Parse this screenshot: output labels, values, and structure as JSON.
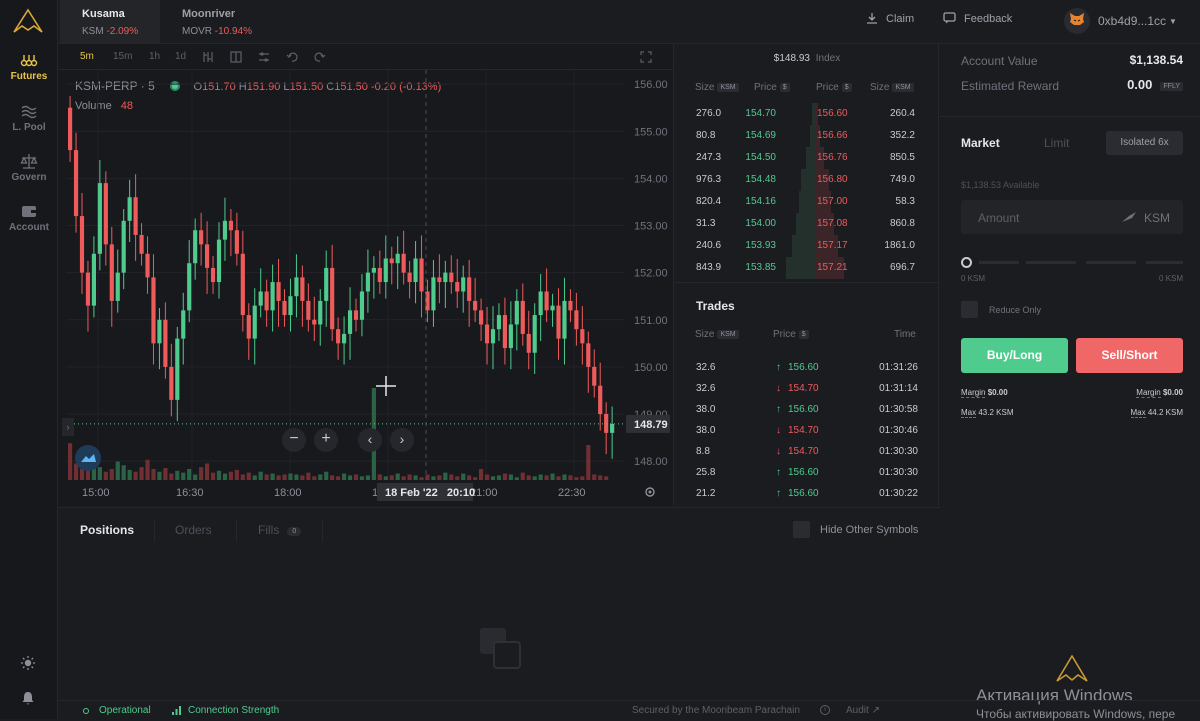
{
  "nav": {
    "items": [
      {
        "label": "Futures",
        "icon": "futures-icon"
      },
      {
        "label": "L. Pool",
        "icon": "pool-icon"
      },
      {
        "label": "Govern",
        "icon": "scale-icon"
      },
      {
        "label": "Account",
        "icon": "wallet-icon"
      }
    ]
  },
  "markets": [
    {
      "name": "Kusama",
      "symbol": "KSM",
      "change": "-2.09%"
    },
    {
      "name": "Moonriver",
      "symbol": "MOVR",
      "change": "-10.94%"
    }
  ],
  "topbar": {
    "claim": "Claim",
    "feedback": "Feedback",
    "wallet": "0xb4d9...1cc"
  },
  "chart_toolbar": {
    "timeframes": [
      "5m",
      "15m",
      "1h",
      "1d"
    ]
  },
  "chart_data": {
    "type": "candlestick",
    "symbol_label": "KSM-PERP · 5",
    "ohlc": {
      "o": "151.70",
      "h": "151.90",
      "l": "151.50",
      "c": "151.50",
      "change": "-0.20 (-0.13%)"
    },
    "volume_label": "Volume",
    "volume_value": "48",
    "y_ticks": [
      "156.00",
      "155.00",
      "154.00",
      "153.00",
      "152.00",
      "151.00",
      "150.00",
      "149.00",
      "148.00"
    ],
    "ylim": [
      147.6,
      156.3
    ],
    "x_ticks": [
      "15:00",
      "16:30",
      "18:00",
      "19:30",
      "21:00",
      "22:30"
    ],
    "last_price": "148.79",
    "crosshair_label": "18 Feb '22   20:10",
    "closes": [
      154.6,
      153.2,
      152.0,
      151.3,
      152.4,
      153.9,
      152.6,
      151.4,
      152.0,
      153.1,
      153.6,
      152.8,
      152.4,
      151.9,
      150.5,
      151.0,
      150.0,
      149.3,
      150.6,
      151.2,
      152.2,
      152.9,
      152.6,
      152.1,
      151.8,
      152.7,
      153.1,
      152.9,
      152.4,
      151.1,
      150.6,
      151.3,
      151.6,
      151.2,
      151.8,
      151.4,
      151.1,
      151.5,
      151.9,
      151.4,
      151.0,
      150.9,
      151.4,
      152.1,
      150.8,
      150.5,
      150.7,
      151.2,
      151.0,
      151.6,
      152.0,
      152.1,
      151.8,
      152.3,
      152.2,
      152.4,
      152.0,
      151.8,
      152.3,
      151.6,
      151.2,
      151.9,
      151.8,
      152.0,
      151.8,
      151.6,
      151.9,
      151.4,
      151.2,
      150.9,
      150.5,
      150.8,
      151.1,
      150.4,
      150.9,
      151.4,
      150.7,
      150.3,
      151.1,
      151.6,
      151.2,
      151.3,
      150.6,
      151.4,
      151.2,
      150.8,
      150.5,
      150.0,
      149.6,
      149.0,
      148.6,
      148.79
    ],
    "volumes": [
      40,
      18,
      12,
      22,
      30,
      14,
      9,
      12,
      20,
      16,
      11,
      9,
      14,
      22,
      12,
      9,
      13,
      7,
      10,
      8,
      12,
      6,
      14,
      18,
      8,
      10,
      7,
      9,
      11,
      6,
      8,
      5,
      9,
      6,
      7,
      5,
      6,
      7,
      6,
      5,
      8,
      4,
      6,
      9,
      5,
      4,
      7,
      5,
      6,
      4,
      5,
      100,
      6,
      4,
      5,
      7,
      4,
      6,
      5,
      3,
      6,
      4,
      5,
      8,
      6,
      4,
      7,
      5,
      3,
      12,
      6,
      4,
      5,
      7,
      6,
      3,
      8,
      5,
      4,
      6,
      5,
      7,
      4,
      6,
      5,
      3,
      4,
      38,
      6,
      5,
      4
    ]
  },
  "orderbook": {
    "index_price": "$148.93",
    "index_label": "Index",
    "headers": {
      "size": "Size",
      "price": "Price",
      "unit_ksm": "KSM",
      "unit_usd": "$"
    },
    "rows": [
      {
        "bid_size": "276.0",
        "bid": "154.70",
        "ask": "156.60",
        "ask_size": "260.4",
        "depth": 0.1
      },
      {
        "bid_size": "80.8",
        "bid": "154.69",
        "ask": "156.66",
        "ask_size": "352.2",
        "depth": 0.18
      },
      {
        "bid_size": "247.3",
        "bid": "154.50",
        "ask": "156.76",
        "ask_size": "850.5",
        "depth": 0.3
      },
      {
        "bid_size": "976.3",
        "bid": "154.48",
        "ask": "156.80",
        "ask_size": "749.0",
        "depth": 0.45
      },
      {
        "bid_size": "820.4",
        "bid": "154.16",
        "ask": "157.00",
        "ask_size": "58.3",
        "depth": 0.52
      },
      {
        "bid_size": "31.3",
        "bid": "154.00",
        "ask": "157.08",
        "ask_size": "860.8",
        "depth": 0.62
      },
      {
        "bid_size": "240.6",
        "bid": "153.93",
        "ask": "157.17",
        "ask_size": "1861.0",
        "depth": 0.78
      },
      {
        "bid_size": "843.9",
        "bid": "153.85",
        "ask": "157.21",
        "ask_size": "696.7",
        "depth": 0.95
      }
    ]
  },
  "trades": {
    "title": "Trades",
    "headers": {
      "size": "Size",
      "price": "Price",
      "time": "Time"
    },
    "rows": [
      {
        "size": "32.6",
        "price": "156.60",
        "time": "01:31:26",
        "dir": "up"
      },
      {
        "size": "32.6",
        "price": "154.70",
        "time": "01:31:14",
        "dir": "down"
      },
      {
        "size": "38.0",
        "price": "156.60",
        "time": "01:30:58",
        "dir": "up"
      },
      {
        "size": "38.0",
        "price": "154.70",
        "time": "01:30:46",
        "dir": "down"
      },
      {
        "size": "8.8",
        "price": "154.70",
        "time": "01:30:30",
        "dir": "down"
      },
      {
        "size": "25.8",
        "price": "156.60",
        "time": "01:30:30",
        "dir": "up"
      },
      {
        "size": "21.2",
        "price": "156.60",
        "time": "01:30:22",
        "dir": "up"
      }
    ]
  },
  "account": {
    "value_label": "Account Value",
    "value": "$1,138.54",
    "reward_label": "Estimated Reward",
    "reward": "0.00",
    "reward_unit": "FFLY"
  },
  "order_form": {
    "tabs": [
      "Market",
      "Limit"
    ],
    "margin_mode": "Isolated 6x",
    "available": "$1,138.53 Available",
    "amount_placeholder": "Amount",
    "amount_unit": "KSM",
    "slider_min": "0 KSM",
    "slider_max": "0 KSM",
    "reduce_only": "Reduce Only",
    "buy_label": "Buy/Long",
    "sell_label": "Sell/Short",
    "buy_margin_label": "Margin",
    "buy_margin": "$0.00",
    "buy_max_label": "Max",
    "buy_max": "43.2 KSM",
    "sell_margin_label": "Margin",
    "sell_margin": "$0.00",
    "sell_max_label": "Max",
    "sell_max": "44.2 KSM"
  },
  "positions": {
    "tabs": [
      "Positions",
      "Orders",
      "Fills"
    ],
    "fills_count": "0",
    "hide_other": "Hide Other Symbols"
  },
  "status": {
    "operational": "Operational",
    "connection": "Connection Strength",
    "secured": "Secured by the Moonbeam Parachain",
    "audit": "Audit"
  },
  "watermark": {
    "line1": "Активация Windows",
    "line2": "Чтобы активировать Windows, пере"
  },
  "colors": {
    "accent": "#e8c547",
    "up": "#4ecb8d",
    "down": "#ef5b5b",
    "buy": "#4ecb8d",
    "sell": "#ef6767"
  }
}
